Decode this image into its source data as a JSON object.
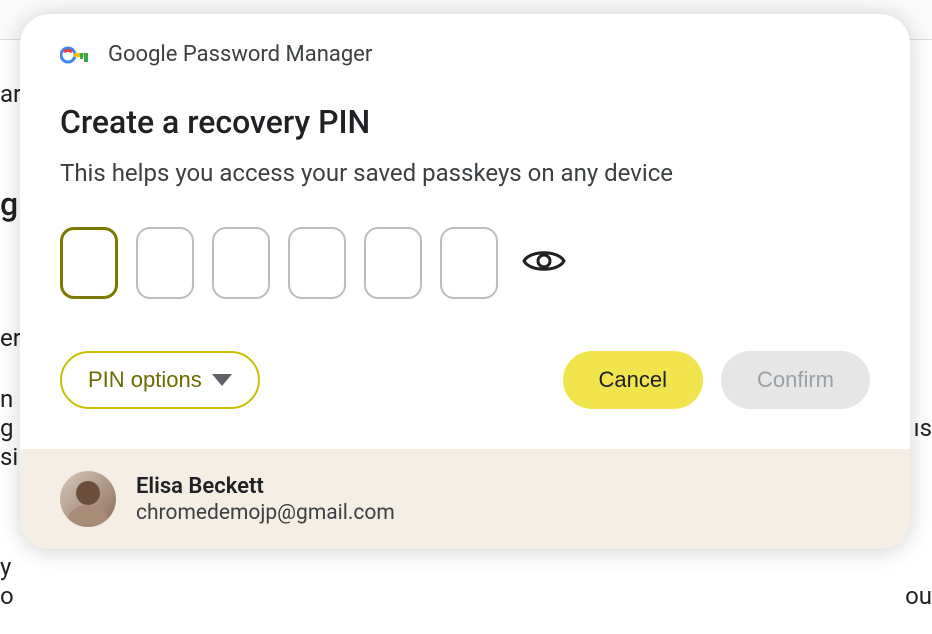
{
  "header": {
    "product_name": "Google Password Manager"
  },
  "dialog": {
    "title": "Create a recovery PIN",
    "subtitle": "This helps you access your saved passkeys on any device",
    "pin_length": 6,
    "pin_options_label": "PIN options",
    "cancel_label": "Cancel",
    "confirm_label": "Confirm"
  },
  "user": {
    "name": "Elisa Beckett",
    "email": "chromedemojp@gmail.com"
  },
  "bg_fragments": {
    "f1": "ar",
    "f2": "g",
    "f3": "er",
    "f4": "n i",
    "f5": "g",
    "f5b": "ıs",
    "f6": "si",
    "f7": "y",
    "f8": "o",
    "f8b": "ou"
  }
}
